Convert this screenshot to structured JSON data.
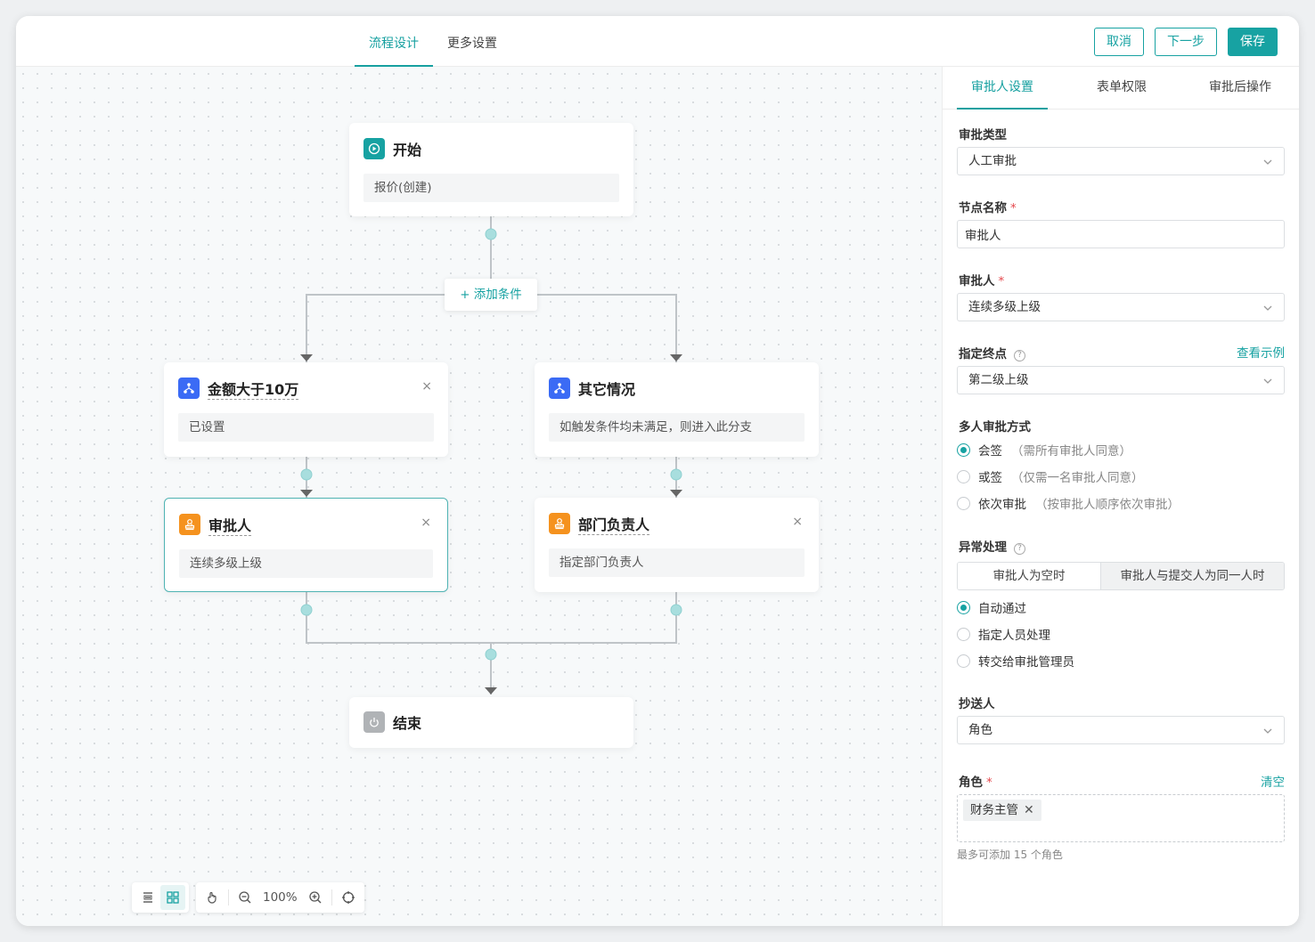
{
  "top_tabs": [
    {
      "label": "流程设计"
    },
    {
      "label": "更多设置"
    }
  ],
  "actions": {
    "cancel": "取消",
    "next": "下一步",
    "save": "保存"
  },
  "colors": {
    "accent": "#17a2a2",
    "condition_icon": "#3b6bf5",
    "approver_icon": "#f5921e",
    "end_icon": "#b0b3b6"
  },
  "flow": {
    "start": {
      "title": "开始",
      "desc": "报价(创建)",
      "icon": "play-icon"
    },
    "add_condition": "+ 添加条件",
    "branches": [
      {
        "condition": {
          "title": "金额大于10万",
          "desc": "已设置",
          "icon": "branch-icon"
        },
        "approver": {
          "title": "审批人",
          "desc": "连续多级上级",
          "icon": "stamp-icon"
        }
      },
      {
        "condition": {
          "title": "其它情况",
          "desc": "如触发条件均未满足，则进入此分支",
          "icon": "branch-icon"
        },
        "approver": {
          "title": "部门负责人",
          "desc": "指定部门负责人",
          "icon": "stamp-icon"
        }
      }
    ],
    "end": {
      "title": "结束",
      "icon": "power-icon"
    }
  },
  "close_glyph": "×",
  "toolbar": {
    "zoom": "100%"
  },
  "panel": {
    "tabs": [
      {
        "label": "审批人设置"
      },
      {
        "label": "表单权限"
      },
      {
        "label": "审批后操作"
      }
    ],
    "approval_type": {
      "label": "审批类型",
      "value": "人工审批"
    },
    "node_name": {
      "label": "节点名称",
      "value": "审批人"
    },
    "approver": {
      "label": "审批人",
      "value": "连续多级上级"
    },
    "endpoint": {
      "label": "指定终点",
      "link": "查看示例",
      "value": "第二级上级"
    },
    "multi_mode": {
      "label": "多人审批方式",
      "options": [
        {
          "label": "会签",
          "hint": "（需所有审批人同意）",
          "checked": true
        },
        {
          "label": "或签",
          "hint": "（仅需一名审批人同意）",
          "checked": false
        },
        {
          "label": "依次审批",
          "hint": "（按审批人顺序依次审批）",
          "checked": false
        }
      ]
    },
    "exception": {
      "label": "异常处理",
      "segments": [
        "审批人为空时",
        "审批人与提交人为同一人时"
      ],
      "options": [
        {
          "label": "自动通过",
          "checked": true
        },
        {
          "label": "指定人员处理",
          "checked": false
        },
        {
          "label": "转交给审批管理员",
          "checked": false
        }
      ]
    },
    "cc": {
      "label": "抄送人",
      "value": "角色"
    },
    "role": {
      "label": "角色",
      "link": "清空",
      "tags": [
        "财务主管"
      ],
      "hint": "最多可添加 15 个角色"
    },
    "required_mark": "*",
    "help_mark": "?"
  }
}
